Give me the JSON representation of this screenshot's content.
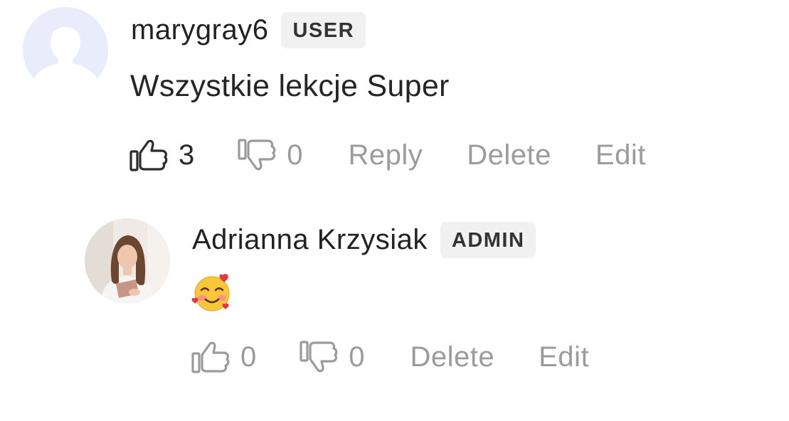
{
  "comments": [
    {
      "author": "marygray6",
      "role_badge": "USER",
      "text": "Wszystkie lekcje Super",
      "likes": "3",
      "dislikes": "0",
      "actions": {
        "reply": "Reply",
        "delete": "Delete",
        "edit": "Edit"
      },
      "avatar_icon": "default-person-avatar"
    },
    {
      "author": "Adrianna Krzysiak",
      "role_badge": "ADMIN",
      "text_emoji": "smiling-face-with-hearts",
      "likes": "0",
      "dislikes": "0",
      "actions": {
        "delete": "Delete",
        "edit": "Edit"
      },
      "avatar_icon": "profile-photo"
    }
  ],
  "colors": {
    "badge_bg": "#f1f1f1",
    "muted_text": "#9b9b9b",
    "default_avatar_bg": "#e9edfb"
  }
}
